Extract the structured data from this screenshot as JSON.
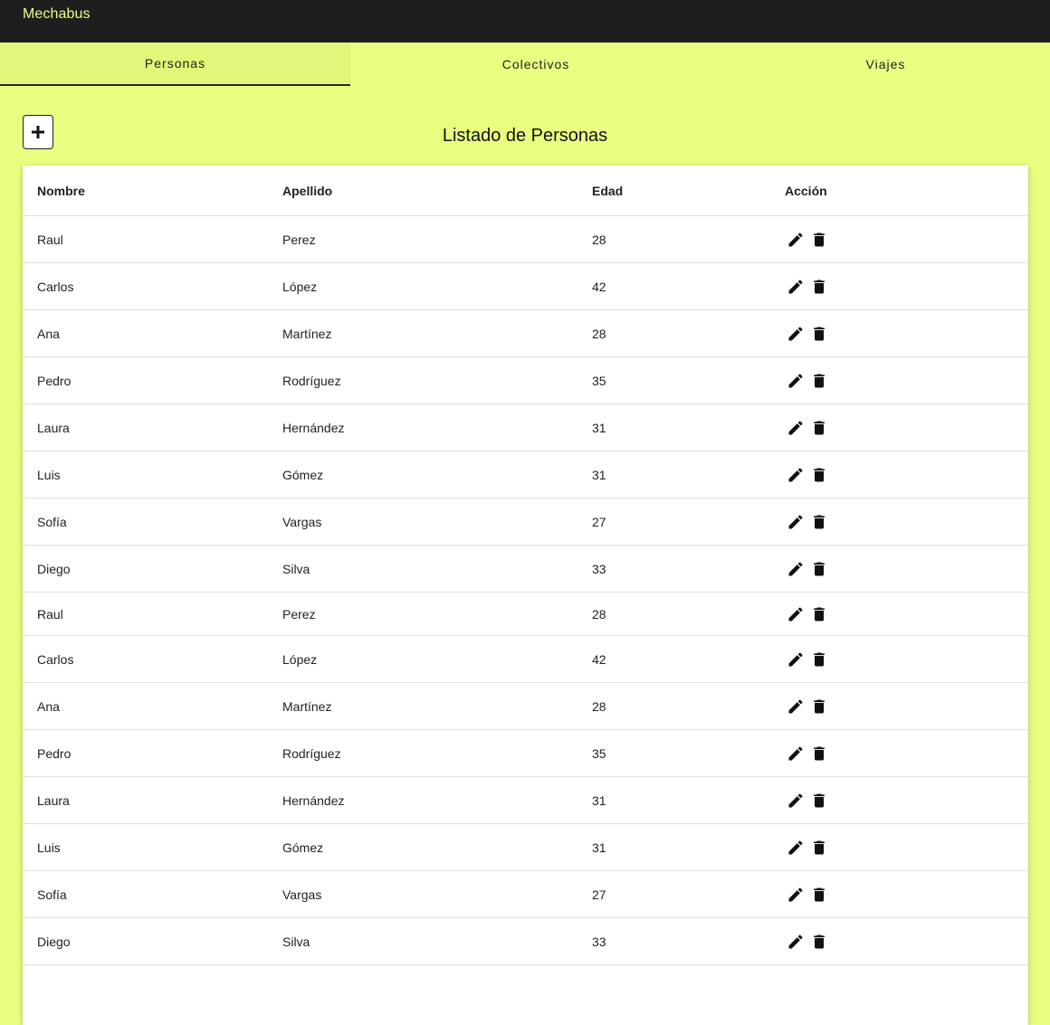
{
  "app": {
    "title": "Mechabus"
  },
  "tabs": [
    {
      "label": "Personas"
    },
    {
      "label": "Colectivos"
    },
    {
      "label": "Viajes"
    }
  ],
  "page": {
    "title": "Listado de Personas",
    "add_icon": "plus-icon"
  },
  "table": {
    "headers": [
      "Nombre",
      "Apellido",
      "Edad",
      "Acción"
    ],
    "rows": [
      [
        "Raul",
        "Perez",
        "28"
      ],
      [
        "Carlos",
        "López",
        "42"
      ],
      [
        "Ana",
        "Martínez",
        "28"
      ],
      [
        "Pedro",
        "Rodríguez",
        "35"
      ],
      [
        "Laura",
        "Hernández",
        "31"
      ],
      [
        "Luis",
        "Gómez",
        "31"
      ],
      [
        "Sofía",
        "Vargas",
        "27"
      ],
      [
        "Diego",
        "Silva",
        "33"
      ],
      [
        "Raul",
        "Perez",
        "28"
      ],
      [
        "Carlos",
        "López",
        "42"
      ],
      [
        "Ana",
        "Martínez",
        "28"
      ],
      [
        "Pedro",
        "Rodríguez",
        "35"
      ],
      [
        "Laura",
        "Hernández",
        "31"
      ],
      [
        "Luis",
        "Gómez",
        "31"
      ],
      [
        "Sofía",
        "Vargas",
        "27"
      ],
      [
        "Diego",
        "Silva",
        "33"
      ]
    ],
    "action_icons": [
      "edit-icon",
      "delete-icon"
    ]
  },
  "colors": {
    "accent": "#e9ff80",
    "topbar": "#1e1e1e",
    "active_tab": "#e2f77a"
  }
}
